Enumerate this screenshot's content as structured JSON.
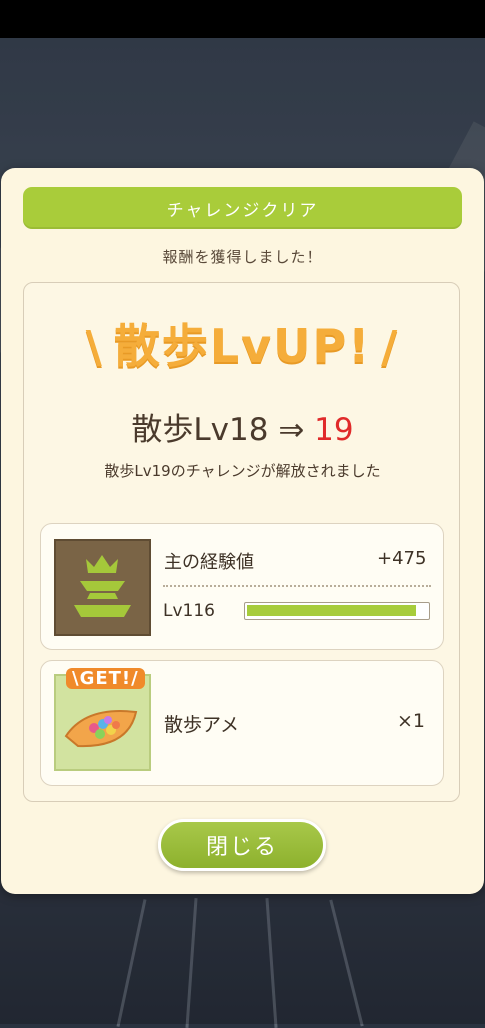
{
  "header": {
    "title": "チャレンジクリア"
  },
  "reward_message": "報酬を獲得しました！",
  "lvup": {
    "slash_left": "\\",
    "text": "散歩LvUP!",
    "slash_right": "/"
  },
  "level_change": {
    "label": "散歩Lv18",
    "arrow": "⇒",
    "new_level": "19"
  },
  "unlock_message": "散歩Lv19のチャレンジが解放されました",
  "exp_card": {
    "icon": "helmet-crest-icon",
    "label": "主の経験値",
    "value": "+475",
    "level_label": "Lv116",
    "progress": 0.94
  },
  "item_card": {
    "icon": "walk-candy-icon",
    "badge": "\\GET!/",
    "name": "散歩アメ",
    "quantity": "×1"
  },
  "close_button": {
    "label": "閉じる"
  },
  "colors": {
    "accent_green": "#a9cc3a",
    "lvup_orange": "#f5ad3a",
    "highlight_red": "#e02a2a",
    "panel_cream": "#fdf6e0",
    "text_brown": "#4a3a2c"
  }
}
